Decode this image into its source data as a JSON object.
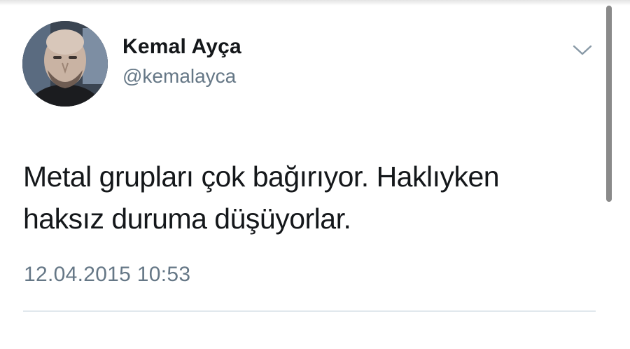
{
  "tweet": {
    "display_name": "Kemal Ayça",
    "handle": "@kemalayca",
    "text_line_1": "Metal grupları çok bağırıyor. Haklıyken",
    "text_line_2": "haksız duruma düşüyorlar.",
    "timestamp": "12.04.2015 10:53"
  },
  "icons": {
    "avatar": "profile-photo",
    "more": "chevron-down-icon"
  },
  "colors": {
    "name": "#14171a",
    "secondary": "#657786",
    "divider": "#e1e8ed"
  }
}
